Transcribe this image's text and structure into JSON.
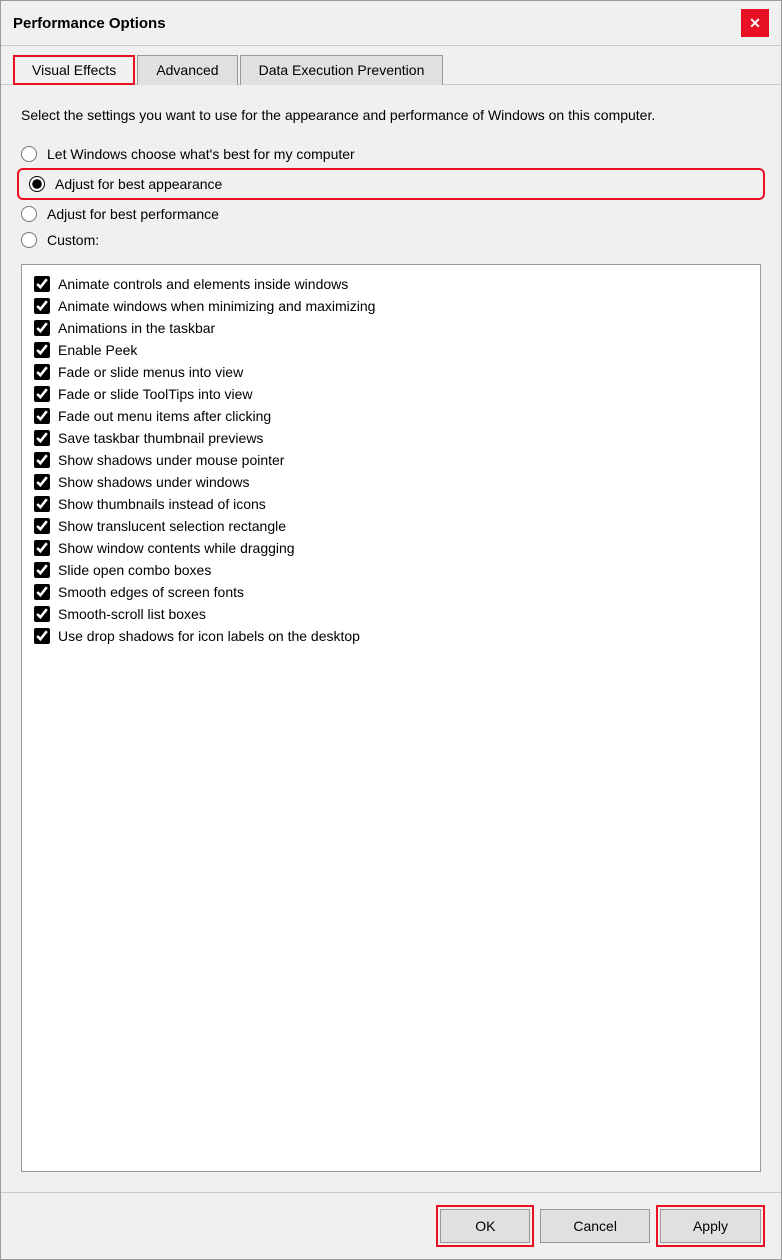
{
  "dialog": {
    "title": "Performance Options",
    "close_label": "✕"
  },
  "tabs": [
    {
      "id": "visual-effects",
      "label": "Visual Effects",
      "active": true
    },
    {
      "id": "advanced",
      "label": "Advanced",
      "active": false
    },
    {
      "id": "dep",
      "label": "Data Execution Prevention",
      "active": false
    }
  ],
  "description": "Select the settings you want to use for the appearance and performance of Windows on this computer.",
  "radio_options": [
    {
      "id": "let-windows",
      "label": "Let Windows choose what's best for my computer",
      "checked": false
    },
    {
      "id": "best-appearance",
      "label": "Adjust for best appearance",
      "checked": true
    },
    {
      "id": "best-performance",
      "label": "Adjust for best performance",
      "checked": false
    },
    {
      "id": "custom",
      "label": "Custom:",
      "checked": false
    }
  ],
  "checkboxes": [
    {
      "id": "animate-controls",
      "label": "Animate controls and elements inside windows",
      "checked": true
    },
    {
      "id": "animate-windows",
      "label": "Animate windows when minimizing and maximizing",
      "checked": true
    },
    {
      "id": "animations-taskbar",
      "label": "Animations in the taskbar",
      "checked": true
    },
    {
      "id": "enable-peek",
      "label": "Enable Peek",
      "checked": true
    },
    {
      "id": "fade-slide-menus",
      "label": "Fade or slide menus into view",
      "checked": true
    },
    {
      "id": "fade-slide-tooltips",
      "label": "Fade or slide ToolTips into view",
      "checked": true
    },
    {
      "id": "fade-menu-items",
      "label": "Fade out menu items after clicking",
      "checked": true
    },
    {
      "id": "save-taskbar-thumbnails",
      "label": "Save taskbar thumbnail previews",
      "checked": true
    },
    {
      "id": "shadows-mouse",
      "label": "Show shadows under mouse pointer",
      "checked": true
    },
    {
      "id": "shadows-windows",
      "label": "Show shadows under windows",
      "checked": true
    },
    {
      "id": "thumbnails-icons",
      "label": "Show thumbnails instead of icons",
      "checked": true
    },
    {
      "id": "translucent-selection",
      "label": "Show translucent selection rectangle",
      "checked": true
    },
    {
      "id": "window-contents-dragging",
      "label": "Show window contents while dragging",
      "checked": true
    },
    {
      "id": "slide-combo",
      "label": "Slide open combo boxes",
      "checked": true
    },
    {
      "id": "smooth-edges",
      "label": "Smooth edges of screen fonts",
      "checked": true
    },
    {
      "id": "smooth-scroll",
      "label": "Smooth-scroll list boxes",
      "checked": true
    },
    {
      "id": "drop-shadows-icons",
      "label": "Use drop shadows for icon labels on the desktop",
      "checked": true
    }
  ],
  "buttons": {
    "ok": "OK",
    "cancel": "Cancel",
    "apply": "Apply"
  }
}
